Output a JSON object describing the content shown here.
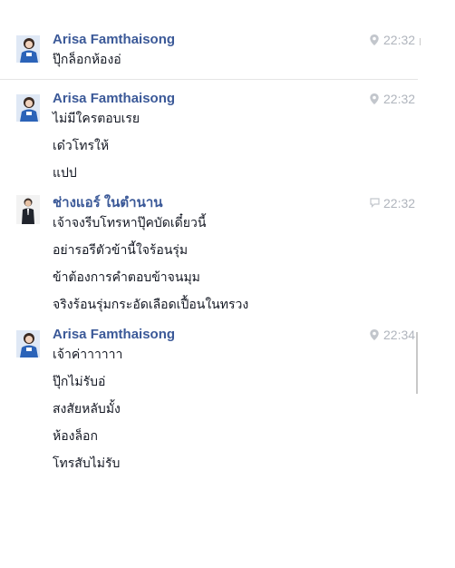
{
  "groups": [
    {
      "sender": "Arisa Famthaisong",
      "time": "22:32",
      "meta_icon": "location-pin-icon",
      "lines": [
        "ปุ๊กล็อกห้องอ่"
      ]
    },
    {
      "sender": "Arisa Famthaisong",
      "time": "22:32",
      "meta_icon": "location-pin-icon",
      "lines": [
        "ไม่มีใครตอบเรย",
        "เด๋วโทรให้",
        "แปป"
      ]
    },
    {
      "sender": "ช่างแอร์ ในตำนาน",
      "time": "22:32",
      "meta_icon": "chat-bubble-icon",
      "lines": [
        "เจ้าจงรีบโทรหาปุ๊คบัดเดี๋ยวนี้",
        "อย่ารอรีตัวข้านี้ใจร้อนรุ่ม",
        "ข้าต้องการคำตอบข้าจนมุม",
        "จริงร้อนรุ่มกระอัดเลือดเปื้อนในทรวง"
      ]
    },
    {
      "sender": "Arisa Famthaisong",
      "time": "22:34",
      "meta_icon": "location-pin-icon",
      "lines": [
        "เจ้าค่าาาาาา",
        "ปุ๊กไม่รับอ่",
        "สงสัยหลับมั้ง",
        "ห้องล็อก",
        "โทรสับไม่รับ"
      ]
    }
  ],
  "colors": {
    "sender": "#3b5998",
    "text": "#141823",
    "meta": "#b0b5bd",
    "divider": "#e5e5e5"
  }
}
